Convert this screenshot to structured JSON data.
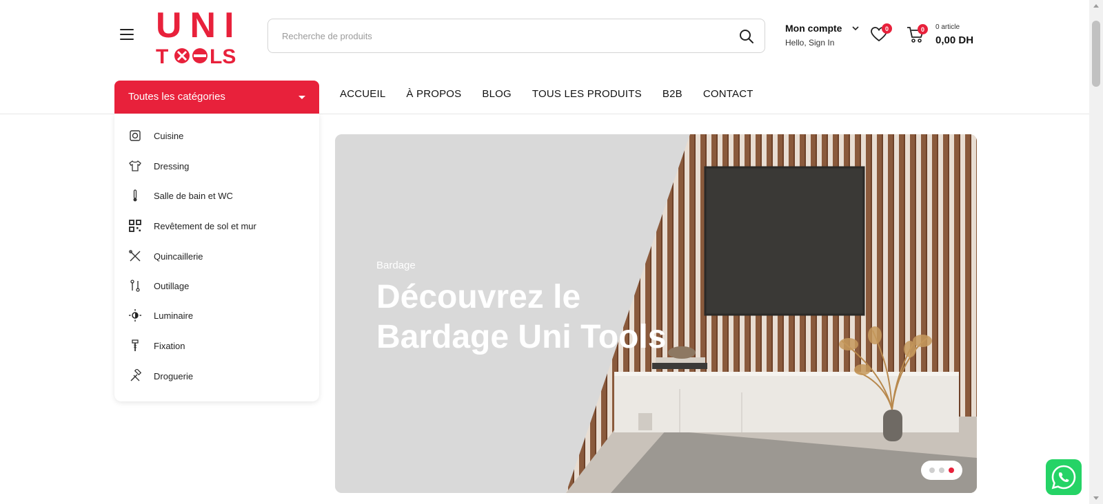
{
  "header": {
    "logo_text": "UNI TOOLS",
    "search_placeholder": "Recherche de produits",
    "account_title": "Mon compte",
    "account_sub": "Hello, Sign In",
    "wishlist_count": "0",
    "cart_count": "0",
    "cart_items": "0 article",
    "cart_total": "0,00 DH"
  },
  "nav": {
    "categories_label": "Toutes les catégories",
    "menu": [
      "ACCUEIL",
      "À PROPOS",
      "BLOG",
      "TOUS LES PRODUITS",
      "B2B",
      "CONTACT"
    ]
  },
  "categories": [
    {
      "label": "Cuisine",
      "icon": "kitchen-icon"
    },
    {
      "label": "Dressing",
      "icon": "shirt-icon"
    },
    {
      "label": "Salle de bain et WC",
      "icon": "thermometer-icon"
    },
    {
      "label": "Revêtement de sol et mur",
      "icon": "grid-tiles-icon"
    },
    {
      "label": "Quincaillerie",
      "icon": "cross-tools-icon"
    },
    {
      "label": "Outillage",
      "icon": "wrench-icon"
    },
    {
      "label": "Luminaire",
      "icon": "light-icon"
    },
    {
      "label": "Fixation",
      "icon": "screw-icon"
    },
    {
      "label": "Droguerie",
      "icon": "hammer-icon"
    }
  ],
  "hero": {
    "kicker": "Bardage",
    "title": "Découvrez le Bardage Uni Tools",
    "slides": 3,
    "active_slide": 3
  },
  "colors": {
    "accent": "#e8213b",
    "whatsapp": "#25d366"
  }
}
